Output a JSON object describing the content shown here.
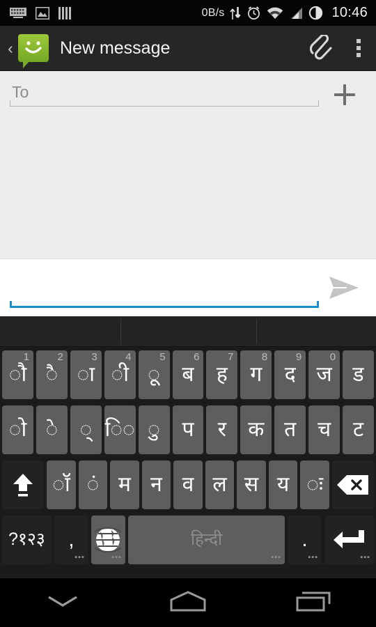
{
  "statusbar": {
    "left_icons": [
      "keyboard-icon",
      "screenshot-image-icon",
      "bars-icon"
    ],
    "network_speed": "0B/s",
    "right_icons": [
      "data-transfer-icon",
      "alarm-clock-icon",
      "wifi-icon",
      "cell-signal-icon",
      "battery-icon"
    ],
    "clock": "10:46"
  },
  "actionbar": {
    "back_label": "‹",
    "app_icon": "messaging-smiley-icon",
    "title": "New message",
    "attach_label": "attach-paperclip-icon",
    "overflow_label": "overflow-menu-icon",
    "accent_green": "#8dbf33",
    "background": "#262626"
  },
  "recipients": {
    "to_placeholder": "To",
    "to_value": "",
    "add_contact_label": "+"
  },
  "compose": {
    "message_placeholder": "",
    "message_value": "",
    "focus_color": "#1a8fd0",
    "send_label": "send-icon",
    "send_enabled": false
  },
  "keyboard": {
    "language": "हिन्दी",
    "suggestions": [
      "",
      "",
      ""
    ],
    "rows": [
      {
        "name": "row-1",
        "keys": [
          {
            "glyph": "◌ौ",
            "num": "1"
          },
          {
            "glyph": "◌ै",
            "num": "2"
          },
          {
            "glyph": "◌ा",
            "num": "3"
          },
          {
            "glyph": "◌ी",
            "num": "4"
          },
          {
            "glyph": "◌ू",
            "num": "5"
          },
          {
            "glyph": "ब",
            "num": "6"
          },
          {
            "glyph": "ह",
            "num": "7"
          },
          {
            "glyph": "ग",
            "num": "8"
          },
          {
            "glyph": "द",
            "num": "9"
          },
          {
            "glyph": "ज",
            "num": "0"
          },
          {
            "glyph": "ड",
            "num": ""
          }
        ]
      },
      {
        "name": "row-2",
        "keys": [
          {
            "glyph": "◌ो",
            "num": ""
          },
          {
            "glyph": "◌े",
            "num": ""
          },
          {
            "glyph": "◌्",
            "num": ""
          },
          {
            "glyph": "ि◌",
            "num": ""
          },
          {
            "glyph": "◌ु",
            "num": ""
          },
          {
            "glyph": "प",
            "num": ""
          },
          {
            "glyph": "र",
            "num": ""
          },
          {
            "glyph": "क",
            "num": ""
          },
          {
            "glyph": "त",
            "num": ""
          },
          {
            "glyph": "च",
            "num": ""
          },
          {
            "glyph": "ट",
            "num": ""
          }
        ]
      },
      {
        "name": "row-3",
        "keys": [
          {
            "glyph": "◌ॉ",
            "num": ""
          },
          {
            "glyph": "◌ं",
            "num": ""
          },
          {
            "glyph": "म",
            "num": ""
          },
          {
            "glyph": "न",
            "num": ""
          },
          {
            "glyph": "व",
            "num": ""
          },
          {
            "glyph": "ल",
            "num": ""
          },
          {
            "glyph": "स",
            "num": ""
          },
          {
            "glyph": "य",
            "num": ""
          },
          {
            "glyph": "◌ः",
            "num": ""
          }
        ]
      }
    ],
    "shift_label": "shift-icon",
    "delete_label": "backspace-icon",
    "symbols_label": "?१२३",
    "comma_label": ",",
    "globe_label": "language-globe-icon",
    "period_label": ".",
    "enter_label": "enter-icon",
    "long_press_hint": "▪▪▪"
  },
  "navbar": {
    "back_label": "hide-keyboard-chevron-icon",
    "home_label": "home-icon",
    "recents_label": "recent-apps-icon"
  }
}
